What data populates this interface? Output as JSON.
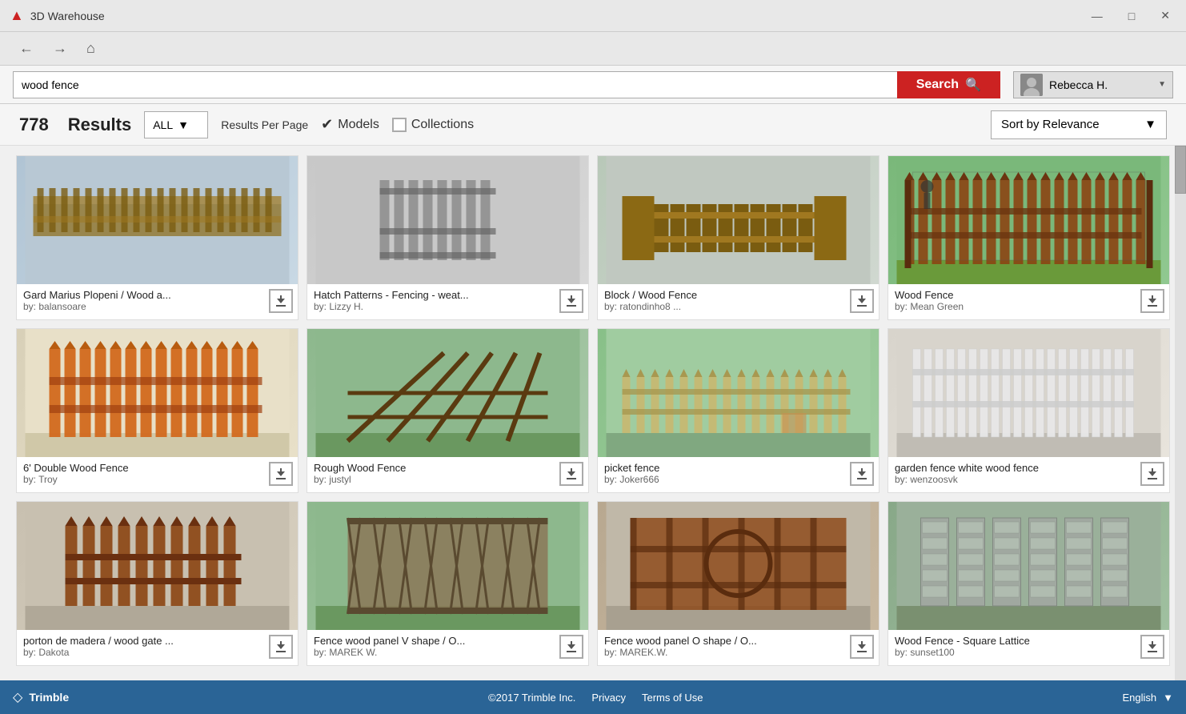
{
  "app": {
    "title": "3D Warehouse",
    "logo": "▲"
  },
  "titlebar": {
    "minimize": "—",
    "maximize": "□",
    "close": "✕"
  },
  "nav": {
    "back": "←",
    "forward": "→",
    "home": "⌂"
  },
  "search": {
    "query": "wood fence",
    "placeholder": "Search",
    "button_label": "Search",
    "search_icon": "🔍"
  },
  "user": {
    "name": "Rebecca H.",
    "avatar": "👤"
  },
  "results": {
    "count": "778",
    "label": "Results",
    "filter_label": "ALL",
    "results_per_page_label": "Results Per Page",
    "models_label": "Models",
    "collections_label": "Collections",
    "sort_label": "Sort by Relevance",
    "models_checked": true,
    "collections_checked": false
  },
  "models": [
    {
      "id": 1,
      "name": "Gard Marius Plopeni / Wood a...",
      "author": "by: balansoare",
      "thumb_class": "thumb-1",
      "thumb_icon": "🏗"
    },
    {
      "id": 2,
      "name": "Hatch Patterns - Fencing - weat...",
      "author": "by: Lizzy H.",
      "thumb_class": "thumb-2",
      "thumb_icon": "🏗"
    },
    {
      "id": 3,
      "name": "Block / Wood Fence",
      "author": "by: ratondinho8 ...",
      "thumb_class": "thumb-3",
      "thumb_icon": "🏗"
    },
    {
      "id": 4,
      "name": "Wood Fence",
      "author": "by: Mean Green",
      "thumb_class": "thumb-4",
      "thumb_icon": "🏗"
    },
    {
      "id": 5,
      "name": "6' Double Wood Fence",
      "author": "by: Troy",
      "thumb_class": "thumb-5",
      "thumb_icon": "🏗"
    },
    {
      "id": 6,
      "name": "Rough Wood Fence",
      "author": "by: justyl",
      "thumb_class": "thumb-6",
      "thumb_icon": "🏗"
    },
    {
      "id": 7,
      "name": "picket fence",
      "author": "by: Joker666",
      "thumb_class": "thumb-7",
      "thumb_icon": "🏗"
    },
    {
      "id": 8,
      "name": "garden fence white wood fence",
      "author": "by: wenzoosvk",
      "thumb_class": "thumb-8",
      "thumb_icon": "🏗"
    },
    {
      "id": 9,
      "name": "porton de madera / wood gate ...",
      "author": "by: Dakota",
      "thumb_class": "thumb-9",
      "thumb_icon": "🏗"
    },
    {
      "id": 10,
      "name": "Fence wood panel V shape / O...",
      "author": "by: MAREK W.",
      "thumb_class": "thumb-10",
      "thumb_icon": "🏗"
    },
    {
      "id": 11,
      "name": "Fence wood panel O shape / O...",
      "author": "by: MAREK.W.",
      "thumb_class": "thumb-11",
      "thumb_icon": "🏗"
    },
    {
      "id": 12,
      "name": "Wood Fence - Square Lattice",
      "author": "by: sunset100",
      "thumb_class": "thumb-12",
      "thumb_icon": "🏗"
    }
  ],
  "footer": {
    "brand": "Trimble",
    "brand_icon": "◇",
    "copyright": "©2017 Trimble Inc.",
    "privacy": "Privacy",
    "terms": "Terms of Use",
    "language": "English",
    "language_arrow": "▼"
  }
}
